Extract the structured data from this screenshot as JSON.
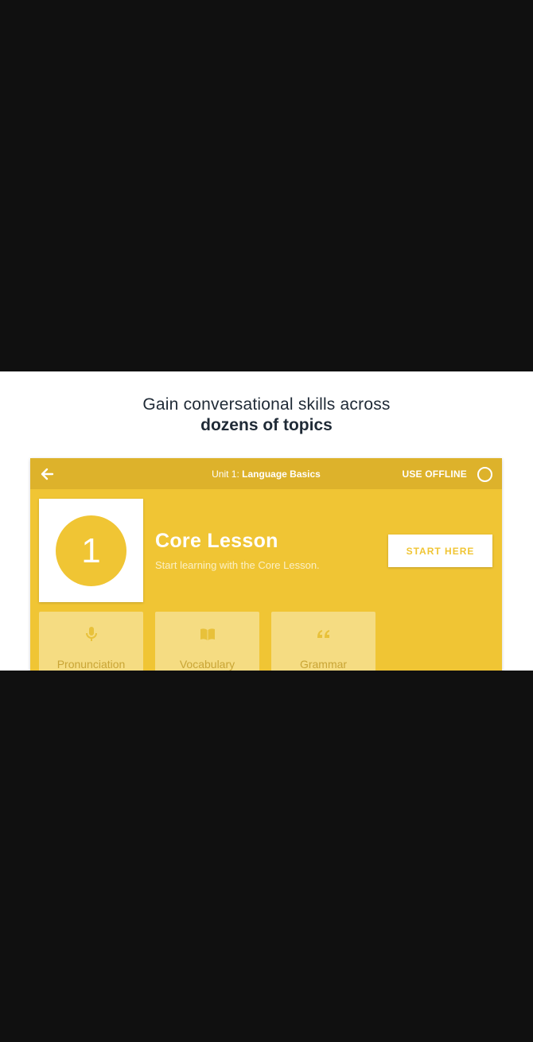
{
  "headline": {
    "line1": "Gain conversational skills across",
    "line2": "dozens of topics"
  },
  "topbar": {
    "unit_prefix": "Unit 1:",
    "unit_name": "Language Basics",
    "offline_label": "USE OFFLINE"
  },
  "lesson": {
    "number": "1",
    "title": "Core Lesson",
    "subtitle": "Start learning with the Core Lesson.",
    "start_label": "START HERE"
  },
  "skills": [
    {
      "label": "Pronunciation",
      "icon": "microphone-icon"
    },
    {
      "label": "Vocabulary",
      "icon": "book-icon"
    },
    {
      "label": "Grammar",
      "icon": "quote-icon"
    }
  ],
  "colors": {
    "accent": "#f0c534",
    "topbar": "#ddb22b",
    "skill_tile": "#f5dc82",
    "headline_text": "#1f2a36"
  }
}
